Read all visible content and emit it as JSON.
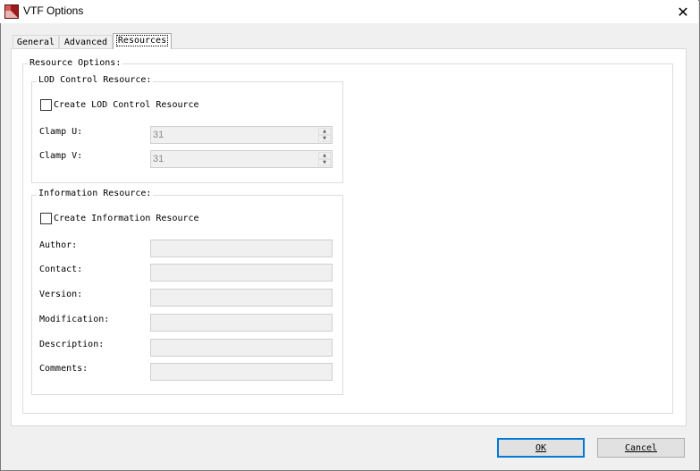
{
  "window": {
    "title": "VTF Options",
    "close_glyph": "✕",
    "app_icon": "vtf-app-icon"
  },
  "tabs": [
    {
      "label": "General",
      "selected": false
    },
    {
      "label": "Advanced",
      "selected": false
    },
    {
      "label": "Resources",
      "selected": true
    }
  ],
  "resource_options": {
    "label": "Resource Options:",
    "lod": {
      "group_label": "LOD Control Resource:",
      "checkbox_label": "Create LOD Control Resource",
      "checked": false,
      "clamp_u_label": "Clamp U:",
      "clamp_u_value": "31",
      "clamp_v_label": "Clamp V:",
      "clamp_v_value": "31"
    },
    "info": {
      "group_label": "Information Resource:",
      "checkbox_label": "Create Information Resource",
      "checked": false,
      "fields": [
        {
          "label": "Author:",
          "value": ""
        },
        {
          "label": "Contact:",
          "value": ""
        },
        {
          "label": "Version:",
          "value": ""
        },
        {
          "label": "Modification:",
          "value": ""
        },
        {
          "label": "Description:",
          "value": ""
        },
        {
          "label": "Comments:",
          "value": ""
        }
      ]
    }
  },
  "buttons": {
    "ok_label": "OK",
    "cancel_label": "Cancel"
  },
  "colors": {
    "default_button_border": "#0078d7",
    "panel_background": "#ffffff",
    "dialog_background": "#f0f0f0"
  }
}
